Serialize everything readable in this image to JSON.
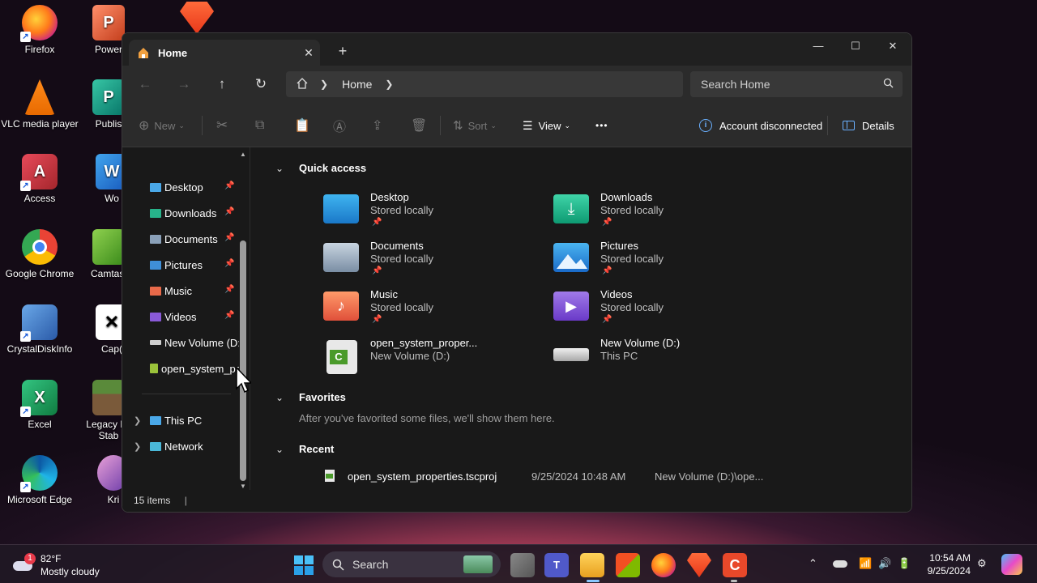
{
  "desktop": {
    "icons": [
      {
        "label": "Firefox"
      },
      {
        "label": "VLC media player"
      },
      {
        "label": "Access"
      },
      {
        "label": "Google Chrome"
      },
      {
        "label": "CrystalDiskInfo"
      },
      {
        "label": "Excel"
      },
      {
        "label": "Microsoft Edge"
      }
    ],
    "icons_col2": [
      {
        "label": "Power"
      },
      {
        "label": "Publis"
      },
      {
        "label": "Wo"
      },
      {
        "label": "Camtasi"
      },
      {
        "label": "Cap("
      },
      {
        "label": "Legacy La"
      },
      {
        "label": "Stab"
      },
      {
        "label": "Kri"
      }
    ]
  },
  "window": {
    "tab_title": "Home",
    "new_tab": "+",
    "controls": {
      "minimize": "—",
      "maximize": "☐",
      "close": "✕"
    },
    "breadcrumb": [
      "Home"
    ],
    "search_placeholder": "Search Home",
    "toolbar": {
      "new_label": "New",
      "sort_label": "Sort",
      "view_label": "View",
      "more_label": "•••",
      "account_label": "Account disconnected",
      "details_label": "Details"
    },
    "sidebar": {
      "pinned": [
        {
          "label": "Desktop",
          "color": "#4aa8e8"
        },
        {
          "label": "Downloads",
          "color": "#27b38a"
        },
        {
          "label": "Documents",
          "color": "#8aa0b8"
        },
        {
          "label": "Pictures",
          "color": "#3f8fd8"
        },
        {
          "label": "Music",
          "color": "#e86a4a"
        },
        {
          "label": "Videos",
          "color": "#8a5ad8"
        },
        {
          "label": "New Volume (D:)",
          "color": "#cfcfcf"
        },
        {
          "label": "open_system_proj",
          "color": "#9ac23a"
        }
      ],
      "roots": [
        {
          "label": "This PC"
        },
        {
          "label": "Network"
        }
      ]
    },
    "sections": {
      "quick_access": "Quick access",
      "favorites": "Favorites",
      "favorites_hint": "After you've favorited some files, we'll show them here.",
      "recent": "Recent"
    },
    "quick_access": [
      {
        "name": "Desktop",
        "sub": "Stored locally",
        "pinned": "📌"
      },
      {
        "name": "Downloads",
        "sub": "Stored locally",
        "pinned": "📌"
      },
      {
        "name": "Documents",
        "sub": "Stored locally",
        "pinned": "📌"
      },
      {
        "name": "Pictures",
        "sub": "Stored locally",
        "pinned": "📌"
      },
      {
        "name": "Music",
        "sub": "Stored locally",
        "pinned": "📌"
      },
      {
        "name": "Videos",
        "sub": "Stored locally",
        "pinned": "📌"
      },
      {
        "name": "open_system_proper...",
        "sub": "New Volume (D:)"
      },
      {
        "name": "New Volume (D:)",
        "sub": "This PC"
      }
    ],
    "recent_files": [
      {
        "name": "open_system_properties.tscproj",
        "date": "9/25/2024 10:48 AM",
        "location": "New Volume (D:)\\ope..."
      }
    ],
    "status": "15 items"
  },
  "taskbar": {
    "weather_temp": "82°F",
    "weather_desc": "Mostly cloudy",
    "weather_badge": "1",
    "search_label": "Search",
    "time": "10:54 AM",
    "date": "9/25/2024"
  }
}
